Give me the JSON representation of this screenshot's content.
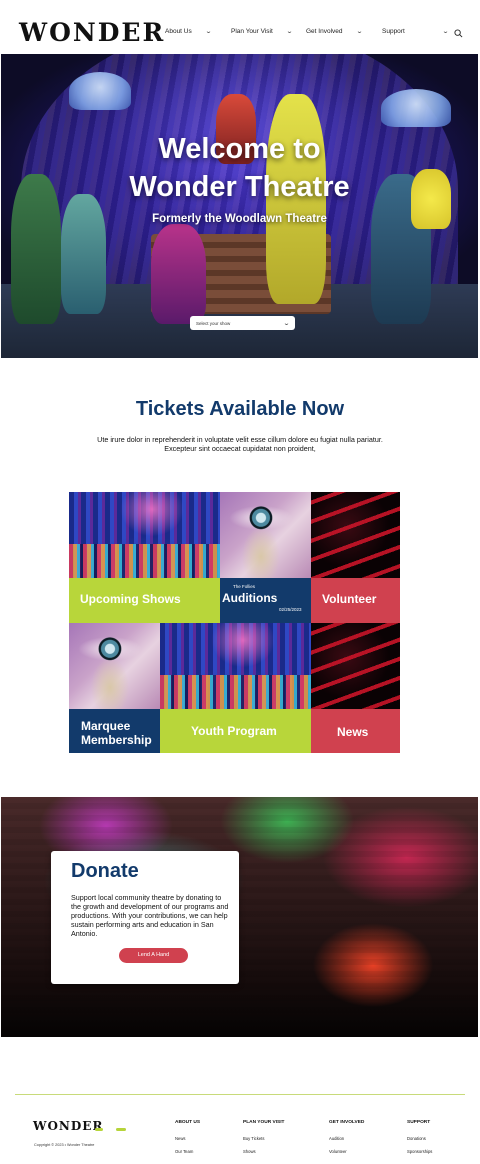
{
  "header": {
    "logo": "WONDER",
    "nav": [
      {
        "label": "About Us"
      },
      {
        "label": "Plan Your Visit"
      },
      {
        "label": "Get Involved"
      },
      {
        "label": "Support"
      }
    ]
  },
  "hero": {
    "title_line1": "Welcome to",
    "title_line2": "Wonder Theatre",
    "subtitle": "Formerly the Woodlawn Theatre",
    "select_placeholder": "Select your show"
  },
  "tickets": {
    "title": "Tickets Available Now",
    "description": "Ute irure dolor in reprehenderit in voluptate velit esse cillum dolore eu fugiat nulla pariatur. Excepteur sint occaecat cupidatat non proident,"
  },
  "grid": {
    "upcoming": "Upcoming Shows",
    "auditions_tag": "The Follies",
    "auditions": "Auditions",
    "auditions_date": "02/25/2023",
    "volunteer": "Volunteer",
    "marquee_line1": "Marquee",
    "marquee_line2": "Membership",
    "youth": "Youth Program",
    "news": "News"
  },
  "donate": {
    "title": "Donate",
    "text": "Support local community theatre by donating to the growth and development of our programs and productions. With your contributions, we can help sustain performing arts and education in San Antonio.",
    "button": "Lend A Hand"
  },
  "footer": {
    "logo": "WONDER",
    "copyright": "Copyright © 2023 • Wonder Theatre",
    "columns": [
      {
        "title": "ABOUT US",
        "links": [
          "News",
          "Our Team"
        ]
      },
      {
        "title": "PLAN YOUR VISIT",
        "links": [
          "Buy Tickets",
          "Shows"
        ]
      },
      {
        "title": "GET INVOLVED",
        "links": [
          "Audition",
          "Volunteer"
        ]
      },
      {
        "title": "SUPPORT",
        "links": [
          "Donations",
          "Sponsorships"
        ]
      }
    ]
  },
  "colors": {
    "navy": "#123a6b",
    "lime": "#b8d63a",
    "red": "#d0414f"
  }
}
